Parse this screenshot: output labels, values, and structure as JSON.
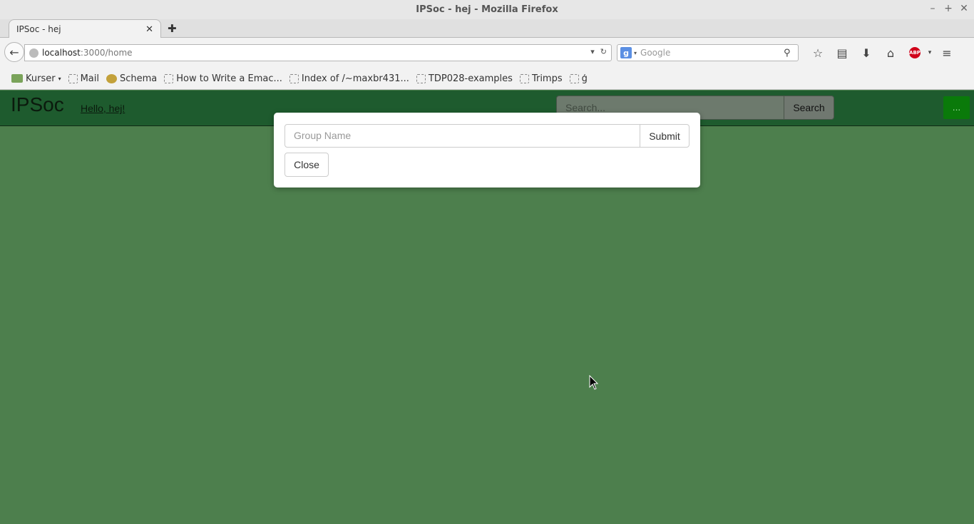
{
  "window": {
    "title": "IPSoc - hej - Mozilla Firefox",
    "controls": {
      "minimize": "–",
      "maximize": "+",
      "close": "✕"
    }
  },
  "tabs": [
    {
      "label": "IPSoc - hej",
      "close": "✕"
    }
  ],
  "new_tab": "✚",
  "nav": {
    "back": "←",
    "url_host": "localhost",
    "url_rest": ":3000/home",
    "url_dropdown": "▾",
    "reload": "↻",
    "search_engine_glyph": "g",
    "search_engine_arrow": "▾",
    "search_placeholder": "Google",
    "search_icon": "⚲",
    "toolbar": {
      "bookmark_star": "☆",
      "reading_list": "▤",
      "downloads": "⬇",
      "home": "⌂",
      "abp": "ABP",
      "abp_arrow": "▾",
      "menu": "≡"
    }
  },
  "bookmarks": [
    {
      "label": "Kurser",
      "icon": "folder-icon",
      "caret": "▾"
    },
    {
      "label": "Mail",
      "icon": "page-icon"
    },
    {
      "label": "Schema",
      "icon": "schema-icon"
    },
    {
      "label": "How to Write a Emac...",
      "icon": "page-icon"
    },
    {
      "label": "Index of /~maxbr431...",
      "icon": "page-icon"
    },
    {
      "label": "TDP028-examples",
      "icon": "page-icon"
    },
    {
      "label": "Trimps",
      "icon": "page-icon"
    },
    {
      "label": "ģ",
      "icon": "page-icon"
    }
  ],
  "app": {
    "brand": "IPSoc",
    "greeting": "Hello, hej!",
    "search_placeholder": "Search...",
    "search_button": "Search",
    "menu_button": "...",
    "colors": {
      "header_bg": "#1e5b2e",
      "page_bg": "#4d7f4d",
      "menu_button_bg": "#0a7a0a"
    }
  },
  "modal": {
    "group_name_placeholder": "Group Name",
    "submit_label": "Submit",
    "close_label": "Close"
  }
}
